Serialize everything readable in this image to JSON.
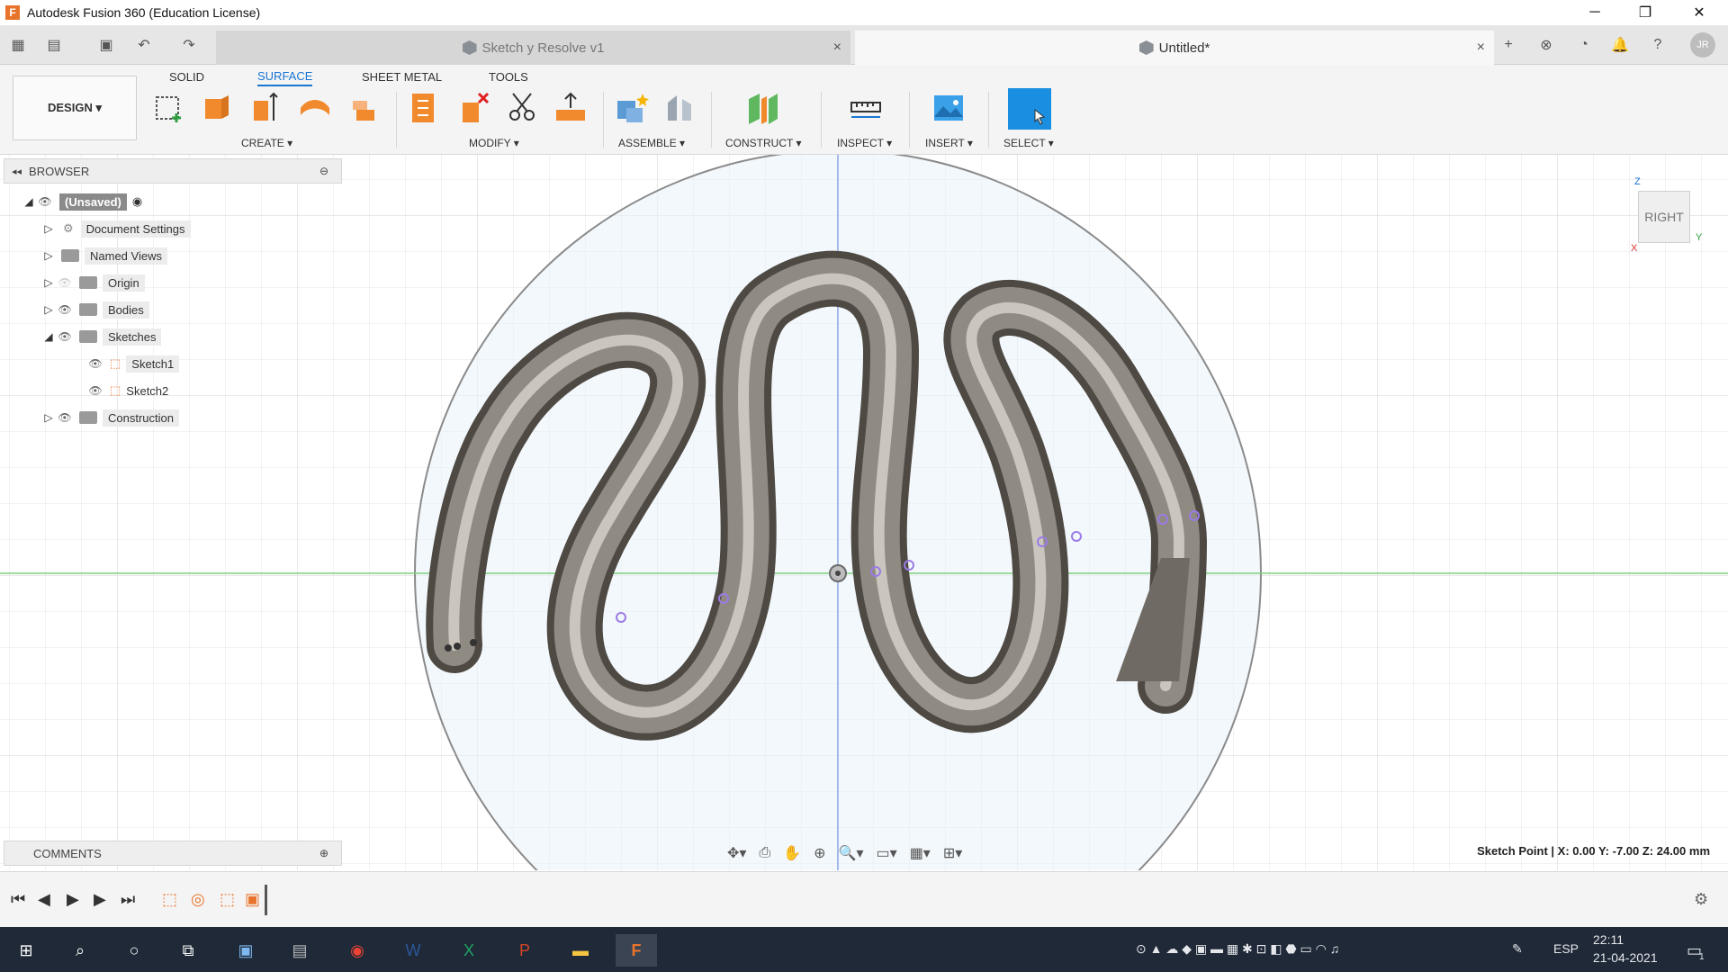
{
  "window": {
    "title": "Autodesk Fusion 360 (Education License)",
    "app_icon_letter": "F",
    "controls": {
      "minimize": "─",
      "restore": "❐",
      "close": "✕"
    }
  },
  "tabs": [
    {
      "label": "Sketch y Resolve v1",
      "active": false
    },
    {
      "label": "Untitled*",
      "active": true
    }
  ],
  "tab_close_glyph": "×",
  "user_initials": "JR",
  "workspace_tabs": [
    "SOLID",
    "SURFACE",
    "SHEET METAL",
    "TOOLS"
  ],
  "design_button": "DESIGN ▾",
  "toolbar_groups": [
    "CREATE ▾",
    "MODIFY ▾",
    "ASSEMBLE ▾",
    "CONSTRUCT ▾",
    "INSPECT ▾",
    "INSERT ▾",
    "SELECT ▾"
  ],
  "browser": {
    "title": "BROWSER",
    "items": [
      {
        "label": "(Unsaved)",
        "level": 0
      },
      {
        "label": "Document Settings",
        "level": 1
      },
      {
        "label": "Named Views",
        "level": 1
      },
      {
        "label": "Origin",
        "level": 1
      },
      {
        "label": "Bodies",
        "level": 1
      },
      {
        "label": "Sketches",
        "level": 1
      },
      {
        "label": "Sketch1",
        "level": 2
      },
      {
        "label": "Sketch2",
        "level": 2
      },
      {
        "label": "Construction",
        "level": 1
      }
    ]
  },
  "comments": {
    "title": "COMMENTS"
  },
  "viewcube": {
    "face": "RIGHT",
    "axis_z": "Z",
    "axis_y": "Y",
    "axis_x": "X"
  },
  "status": "Sketch Point | X: 0.00 Y: -7.00 Z: 24.00 mm",
  "taskbar": {
    "language": "ESP",
    "time": "22:11",
    "date": "21-04-2021",
    "notification_count": "1"
  },
  "colors": {
    "accent": "#1976d2",
    "fusion_orange": "#e8742c",
    "taskbar": "#1f2937"
  }
}
